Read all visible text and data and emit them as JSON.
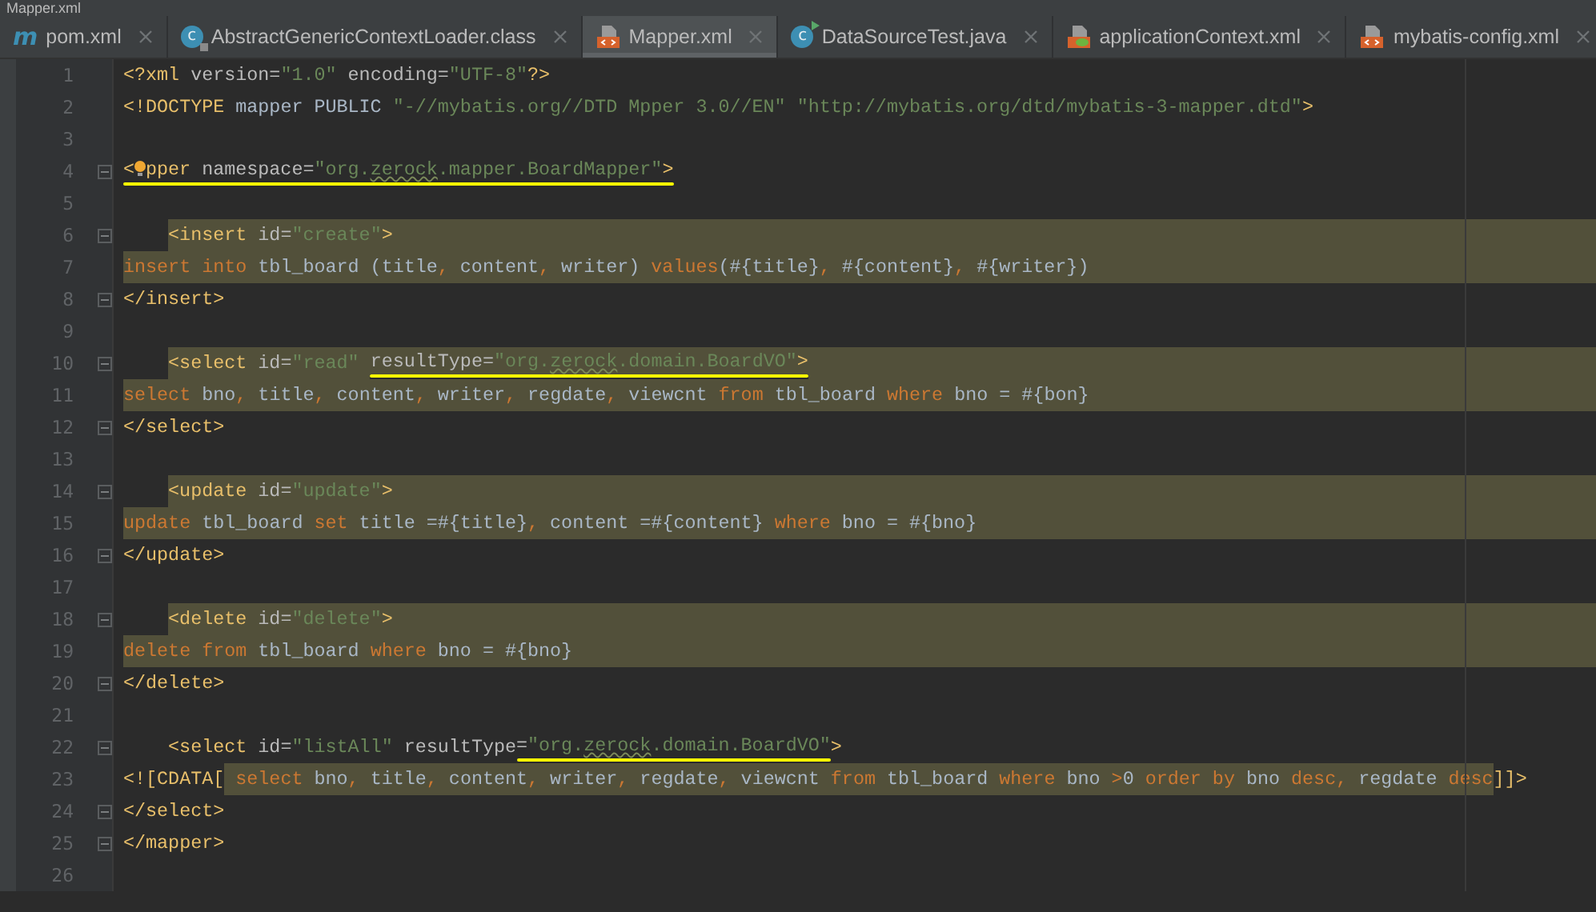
{
  "window": {
    "title": "Mapper.xml"
  },
  "tabs": [
    {
      "label": "pom.xml",
      "kind": "maven",
      "icon_letter": "m",
      "selected": false
    },
    {
      "label": "AbstractGenericContextLoader.class",
      "kind": "class",
      "icon_letter": "c",
      "selected": false
    },
    {
      "label": "Mapper.xml",
      "kind": "xml",
      "selected": true
    },
    {
      "label": "DataSourceTest.java",
      "kind": "test",
      "icon_letter": "c",
      "selected": false
    },
    {
      "label": "applicationContext.xml",
      "kind": "spring",
      "selected": false
    },
    {
      "label": "mybatis-config.xml",
      "kind": "xml",
      "selected": false
    }
  ],
  "editor": {
    "lines": [
      {
        "number": "1",
        "fold_marker": false,
        "highlight_to_edge": false,
        "segments": [
          {
            "highlighted": false,
            "underlined": false,
            "tokens": [
              {
                "kind": "tag",
                "text": "<?xml"
              },
              {
                "kind": "attr",
                "text": " version="
              },
              {
                "kind": "str",
                "text": "\"1.0\""
              },
              {
                "kind": "attr",
                "text": " encoding="
              },
              {
                "kind": "str",
                "text": "\"UTF-8\""
              },
              {
                "kind": "tag",
                "text": "?>"
              }
            ]
          }
        ]
      },
      {
        "number": "2",
        "fold_marker": false,
        "highlight_to_edge": false,
        "segments": [
          {
            "highlighted": false,
            "underlined": false,
            "tokens": [
              {
                "kind": "tag",
                "text": "<!DOCTYPE"
              },
              {
                "kind": "plain",
                "text": " mapper PUBLIC "
              },
              {
                "kind": "str",
                "text": "\"-//mybatis.org//DTD Mpper 3.0//EN\" \"http://mybatis.org/dtd/mybatis-3-mapper.dtd\""
              },
              {
                "kind": "tag",
                "text": ">"
              }
            ]
          }
        ]
      },
      {
        "number": "3",
        "fold_marker": false,
        "highlight_to_edge": false
      },
      {
        "number": "4",
        "fold_marker": true,
        "highlight_to_edge": false,
        "segments": [
          {
            "highlighted": false,
            "underlined": true,
            "tokens": [
              {
                "kind": "tag",
                "text": "<"
              },
              {
                "kind": "bulb"
              },
              {
                "kind": "tag",
                "text": "pper"
              },
              {
                "kind": "attr",
                "text": " namespace="
              },
              {
                "kind": "str",
                "text": "\"org."
              },
              {
                "kind": "misspelled",
                "text": "zerock"
              },
              {
                "kind": "str",
                "text": ".mapper.BoardMapper\""
              },
              {
                "kind": "tag",
                "text": ">"
              }
            ]
          }
        ]
      },
      {
        "number": "5",
        "fold_marker": false,
        "highlight_to_edge": false
      },
      {
        "number": "6",
        "fold_marker": true,
        "highlight_to_edge": true,
        "segments": [
          {
            "indented": true,
            "highlighted": true,
            "underlined": false,
            "tokens": [
              {
                "kind": "tag",
                "text": "<insert"
              },
              {
                "kind": "attr",
                "text": " id="
              },
              {
                "kind": "str",
                "text": "\"create\""
              },
              {
                "kind": "tag",
                "text": ">"
              }
            ]
          }
        ]
      },
      {
        "number": "7",
        "fold_marker": false,
        "highlight_to_edge": true,
        "segments": [
          {
            "highlighted": true,
            "underlined": false,
            "tokens": [
              {
                "kind": "kw",
                "text": "insert into"
              },
              {
                "kind": "plain",
                "text": " tbl_board (title"
              },
              {
                "kind": "kw",
                "text": ","
              },
              {
                "kind": "plain",
                "text": " content"
              },
              {
                "kind": "kw",
                "text": ","
              },
              {
                "kind": "plain",
                "text": " writer) "
              },
              {
                "kind": "kw",
                "text": "values"
              },
              {
                "kind": "plain",
                "text": "(#{title}"
              },
              {
                "kind": "kw",
                "text": ","
              },
              {
                "kind": "plain",
                "text": " #{content}"
              },
              {
                "kind": "kw",
                "text": ","
              },
              {
                "kind": "plain",
                "text": " #{writer})"
              }
            ]
          }
        ]
      },
      {
        "number": "8",
        "fold_marker": true,
        "highlight_to_edge": false,
        "segments": [
          {
            "highlighted": false,
            "underlined": false,
            "tokens": [
              {
                "kind": "tag",
                "text": "</insert>"
              }
            ]
          }
        ]
      },
      {
        "number": "9",
        "fold_marker": false,
        "highlight_to_edge": false
      },
      {
        "number": "10",
        "fold_marker": true,
        "highlight_to_edge": true,
        "segments": [
          {
            "indented": true,
            "highlighted": true,
            "underlined": false,
            "tokens": [
              {
                "kind": "tag",
                "text": "<select"
              },
              {
                "kind": "attr",
                "text": " id="
              },
              {
                "kind": "str",
                "text": "\"read\" "
              }
            ]
          },
          {
            "highlighted": true,
            "underlined": true,
            "tokens": [
              {
                "kind": "attr",
                "text": "resultType="
              },
              {
                "kind": "str",
                "text": "\"org."
              },
              {
                "kind": "misspelled",
                "text": "zerock"
              },
              {
                "kind": "str",
                "text": ".domain.BoardVO\""
              },
              {
                "kind": "tag",
                "text": ">"
              }
            ]
          }
        ]
      },
      {
        "number": "11",
        "fold_marker": false,
        "highlight_to_edge": true,
        "segments": [
          {
            "highlighted": true,
            "underlined": false,
            "tokens": [
              {
                "kind": "kw",
                "text": "select"
              },
              {
                "kind": "plain",
                "text": " bno"
              },
              {
                "kind": "kw",
                "text": ","
              },
              {
                "kind": "plain",
                "text": " title"
              },
              {
                "kind": "kw",
                "text": ","
              },
              {
                "kind": "plain",
                "text": " content"
              },
              {
                "kind": "kw",
                "text": ","
              },
              {
                "kind": "plain",
                "text": " writer"
              },
              {
                "kind": "kw",
                "text": ","
              },
              {
                "kind": "plain",
                "text": " regdate"
              },
              {
                "kind": "kw",
                "text": ","
              },
              {
                "kind": "plain",
                "text": " viewcnt "
              },
              {
                "kind": "kw",
                "text": "from"
              },
              {
                "kind": "plain",
                "text": " tbl_board "
              },
              {
                "kind": "kw",
                "text": "where"
              },
              {
                "kind": "plain",
                "text": " bno = #{bon}"
              }
            ]
          }
        ]
      },
      {
        "number": "12",
        "fold_marker": true,
        "highlight_to_edge": false,
        "segments": [
          {
            "highlighted": false,
            "underlined": false,
            "tokens": [
              {
                "kind": "tag",
                "text": "</select>"
              }
            ]
          }
        ]
      },
      {
        "number": "13",
        "fold_marker": false,
        "highlight_to_edge": false
      },
      {
        "number": "14",
        "fold_marker": true,
        "highlight_to_edge": true,
        "segments": [
          {
            "indented": true,
            "highlighted": true,
            "underlined": false,
            "tokens": [
              {
                "kind": "tag",
                "text": "<update"
              },
              {
                "kind": "attr",
                "text": " id="
              },
              {
                "kind": "str",
                "text": "\"update\""
              },
              {
                "kind": "tag",
                "text": ">"
              }
            ]
          }
        ]
      },
      {
        "number": "15",
        "fold_marker": false,
        "highlight_to_edge": true,
        "segments": [
          {
            "highlighted": true,
            "underlined": false,
            "tokens": [
              {
                "kind": "kw",
                "text": "update"
              },
              {
                "kind": "plain",
                "text": " tbl_board "
              },
              {
                "kind": "kw",
                "text": "set"
              },
              {
                "kind": "plain",
                "text": " title =#{title}"
              },
              {
                "kind": "kw",
                "text": ","
              },
              {
                "kind": "plain",
                "text": " content =#{content} "
              },
              {
                "kind": "kw",
                "text": "where"
              },
              {
                "kind": "plain",
                "text": " bno = #{bno}"
              }
            ]
          }
        ]
      },
      {
        "number": "16",
        "fold_marker": true,
        "highlight_to_edge": false,
        "segments": [
          {
            "highlighted": false,
            "underlined": false,
            "tokens": [
              {
                "kind": "tag",
                "text": "</update>"
              }
            ]
          }
        ]
      },
      {
        "number": "17",
        "fold_marker": false,
        "highlight_to_edge": false
      },
      {
        "number": "18",
        "fold_marker": true,
        "highlight_to_edge": true,
        "segments": [
          {
            "indented": true,
            "highlighted": true,
            "underlined": false,
            "tokens": [
              {
                "kind": "tag",
                "text": "<delete"
              },
              {
                "kind": "attr",
                "text": " id="
              },
              {
                "kind": "str",
                "text": "\"delete\""
              },
              {
                "kind": "tag",
                "text": ">"
              }
            ]
          }
        ]
      },
      {
        "number": "19",
        "fold_marker": false,
        "highlight_to_edge": true,
        "segments": [
          {
            "highlighted": true,
            "underlined": false,
            "tokens": [
              {
                "kind": "kw",
                "text": "delete from"
              },
              {
                "kind": "plain",
                "text": " tbl_board "
              },
              {
                "kind": "kw",
                "text": "where"
              },
              {
                "kind": "plain",
                "text": " bno = #{bno}"
              }
            ]
          }
        ]
      },
      {
        "number": "20",
        "fold_marker": true,
        "highlight_to_edge": false,
        "segments": [
          {
            "highlighted": false,
            "underlined": false,
            "tokens": [
              {
                "kind": "tag",
                "text": "</delete>"
              }
            ]
          }
        ]
      },
      {
        "number": "21",
        "fold_marker": false,
        "highlight_to_edge": false
      },
      {
        "number": "22",
        "fold_marker": true,
        "highlight_to_edge": false,
        "segments": [
          {
            "indented": true,
            "highlighted": false,
            "underlined": false,
            "tokens": [
              {
                "kind": "tag",
                "text": "<select"
              },
              {
                "kind": "attr",
                "text": " id="
              },
              {
                "kind": "str",
                "text": "\"listAll\""
              },
              {
                "kind": "attr",
                "text": " resultType"
              }
            ]
          },
          {
            "highlighted": false,
            "underlined": true,
            "tokens": [
              {
                "kind": "attr",
                "text": "="
              },
              {
                "kind": "str",
                "text": "\"org."
              },
              {
                "kind": "misspelled",
                "text": "zerock"
              },
              {
                "kind": "str",
                "text": ".domain.BoardVO\""
              }
            ]
          },
          {
            "highlighted": false,
            "underlined": false,
            "tokens": [
              {
                "kind": "tag",
                "text": ">"
              }
            ]
          }
        ]
      },
      {
        "number": "23",
        "fold_marker": false,
        "highlight_to_edge": false,
        "segments": [
          {
            "highlighted": false,
            "underlined": false,
            "tokens": [
              {
                "kind": "tag",
                "text": "<![CDATA["
              }
            ]
          },
          {
            "highlighted": true,
            "underlined": false,
            "tokens": [
              {
                "kind": "kw",
                "text": " select"
              },
              {
                "kind": "plain",
                "text": " bno"
              },
              {
                "kind": "kw",
                "text": ","
              },
              {
                "kind": "plain",
                "text": " title"
              },
              {
                "kind": "kw",
                "text": ","
              },
              {
                "kind": "plain",
                "text": " content"
              },
              {
                "kind": "kw",
                "text": ","
              },
              {
                "kind": "plain",
                "text": " writer"
              },
              {
                "kind": "kw",
                "text": ","
              },
              {
                "kind": "plain",
                "text": " regdate"
              },
              {
                "kind": "kw",
                "text": ","
              },
              {
                "kind": "plain",
                "text": " viewcnt "
              },
              {
                "kind": "kw",
                "text": "from"
              },
              {
                "kind": "plain",
                "text": " tbl_board "
              },
              {
                "kind": "kw",
                "text": "where"
              },
              {
                "kind": "plain",
                "text": " bno "
              },
              {
                "kind": "kw",
                "text": ">"
              },
              {
                "kind": "plain",
                "text": "0 "
              },
              {
                "kind": "kw",
                "text": "order by"
              },
              {
                "kind": "plain",
                "text": " bno "
              },
              {
                "kind": "kw",
                "text": "desc"
              },
              {
                "kind": "kw",
                "text": ","
              },
              {
                "kind": "plain",
                "text": " regdate "
              },
              {
                "kind": "kw",
                "text": "desc"
              }
            ]
          },
          {
            "highlighted": false,
            "underlined": false,
            "tokens": [
              {
                "kind": "tag",
                "text": "]]>"
              }
            ]
          }
        ]
      },
      {
        "number": "24",
        "fold_marker": true,
        "highlight_to_edge": false,
        "segments": [
          {
            "highlighted": false,
            "underlined": false,
            "tokens": [
              {
                "kind": "tag",
                "text": "</select>"
              }
            ]
          }
        ]
      },
      {
        "number": "25",
        "fold_marker": true,
        "highlight_to_edge": false,
        "segments": [
          {
            "highlighted": false,
            "underlined": false,
            "tokens": [
              {
                "kind": "tag",
                "text": "</mapper>"
              }
            ]
          }
        ]
      },
      {
        "number": "26",
        "fold_marker": false,
        "highlight_to_edge": false
      }
    ]
  }
}
